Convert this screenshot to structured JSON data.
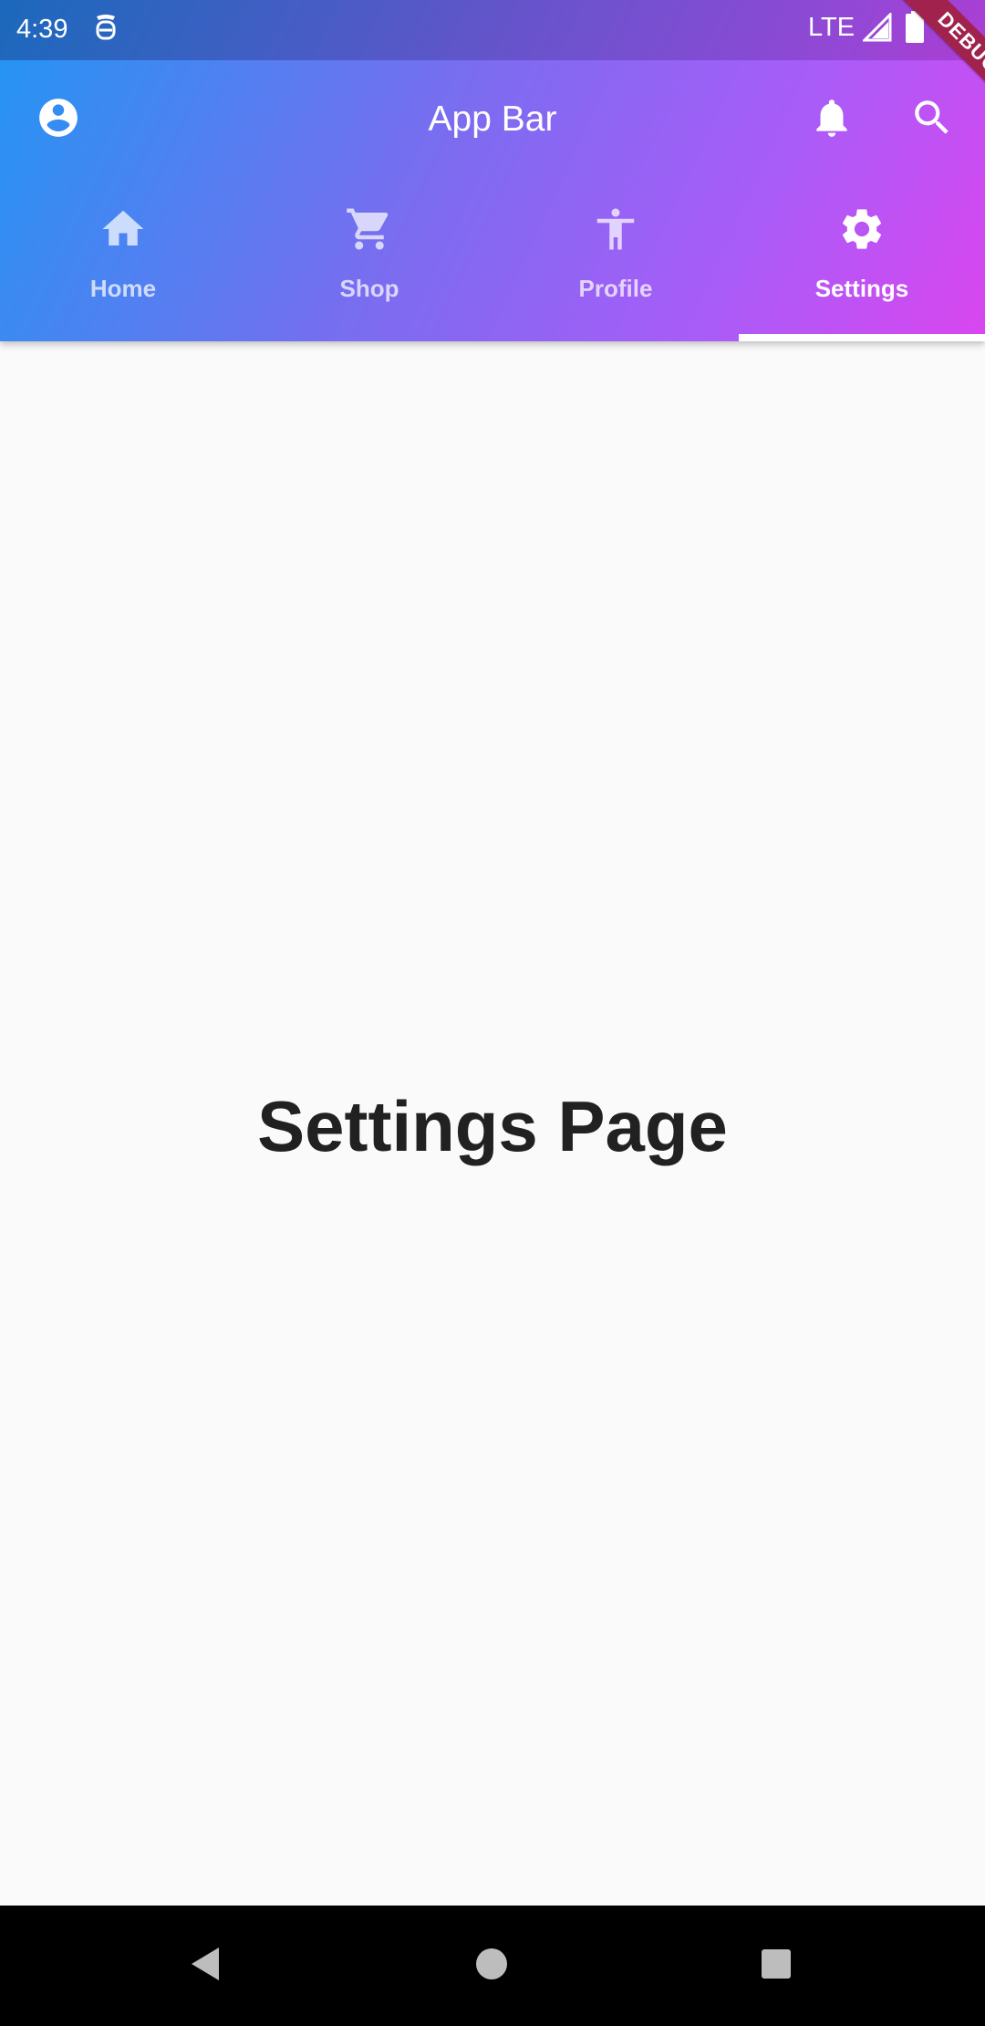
{
  "status_bar": {
    "time": "4:39",
    "network": "LTE",
    "icons": [
      "notification-icon",
      "signal-icon",
      "battery-icon"
    ]
  },
  "debug_banner": {
    "label": "DEBUG"
  },
  "app_bar": {
    "title": "App Bar",
    "leading_icon": "account-circle-icon",
    "actions": [
      "bell-icon",
      "search-icon"
    ]
  },
  "tabs": [
    {
      "label": "Home",
      "icon": "home-icon",
      "selected": false
    },
    {
      "label": "Shop",
      "icon": "cart-icon",
      "selected": false
    },
    {
      "label": "Profile",
      "icon": "accessibility-icon",
      "selected": false
    },
    {
      "label": "Settings",
      "icon": "gear-icon",
      "selected": true
    }
  ],
  "page": {
    "title": "Settings Page"
  },
  "nav_bar": {
    "buttons": [
      "back-icon",
      "home-circle-icon",
      "recents-icon"
    ]
  },
  "colors": {
    "gradient_start": "#2196f3",
    "gradient_end": "#d946ef",
    "body_background": "#fafafa",
    "page_text": "#212121",
    "debug_ribbon": "#a0224d",
    "nav_bar": "#000000"
  }
}
